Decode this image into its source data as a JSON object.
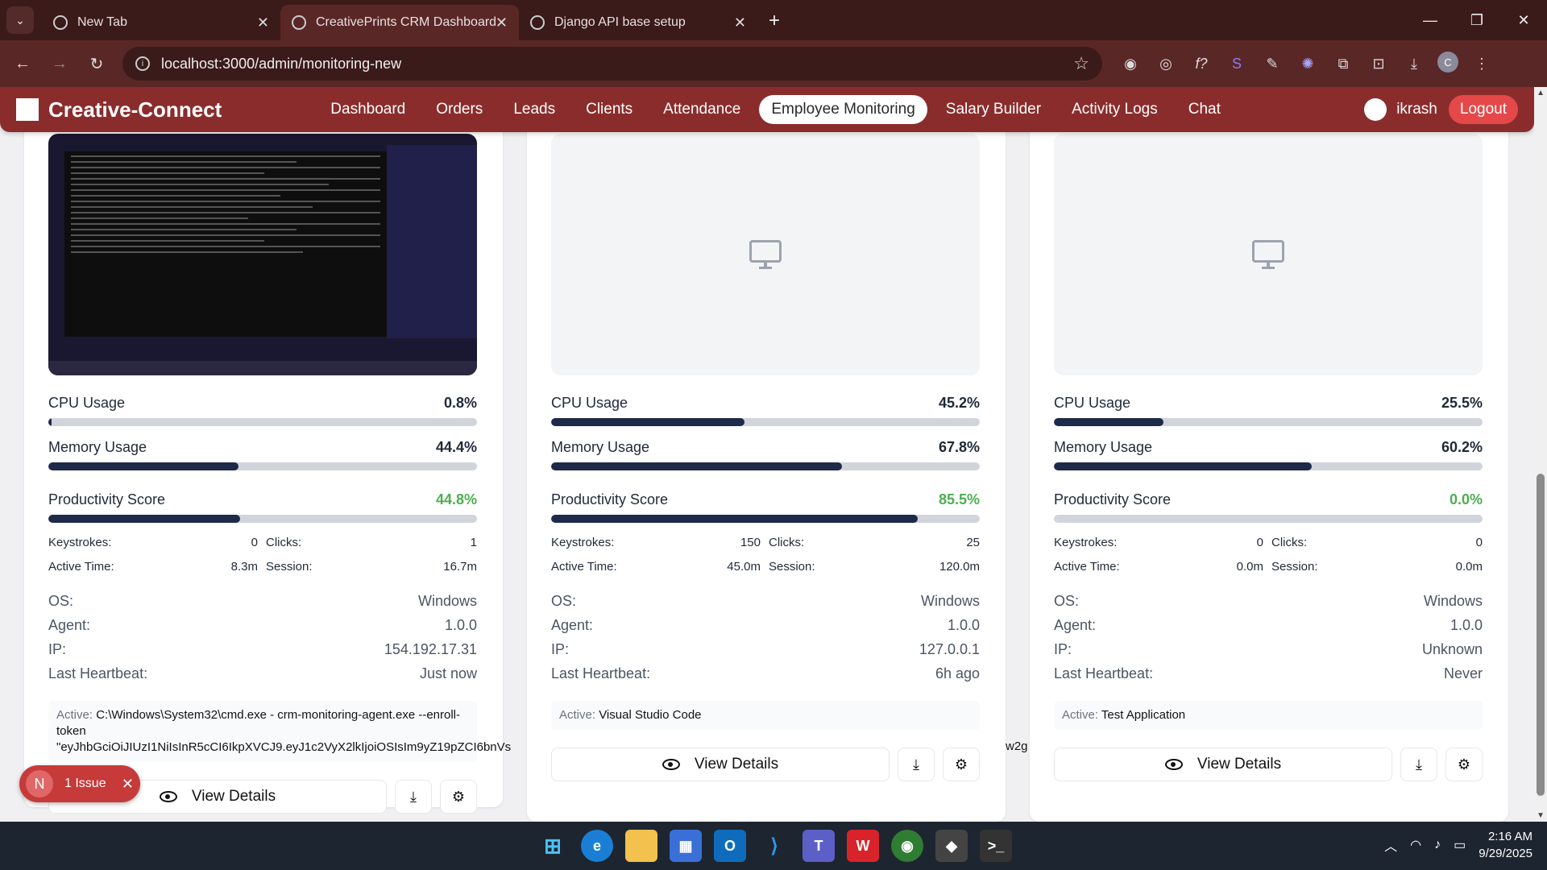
{
  "browser": {
    "tabs": [
      {
        "label": "New Tab",
        "active": false
      },
      {
        "label": "CreativePrints CRM Dashboard",
        "active": true
      },
      {
        "label": "Django API base setup",
        "active": false
      }
    ],
    "url": "localhost:3000/admin/monitoring-new",
    "profile_initial": "C"
  },
  "nav": {
    "brand": "Creative-Connect",
    "links": [
      "Dashboard",
      "Orders",
      "Leads",
      "Clients",
      "Attendance",
      "Employee Monitoring",
      "Salary Builder",
      "Activity Logs",
      "Chat"
    ],
    "active_link": "Employee Monitoring",
    "user": "ikrash",
    "logout": "Logout"
  },
  "labels": {
    "cpu": "CPU Usage",
    "memory": "Memory Usage",
    "productivity": "Productivity Score",
    "keystrokes": "Keystrokes:",
    "clicks": "Clicks:",
    "active_time": "Active Time:",
    "session": "Session:",
    "os": "OS:",
    "agent": "Agent:",
    "ip": "IP:",
    "heartbeat": "Last Heartbeat:",
    "active_prefix": "Active:",
    "view_details": "View Details"
  },
  "cards": [
    {
      "cpu": "0.8%",
      "cpu_pct": 0.8,
      "memory": "44.4%",
      "memory_pct": 44.4,
      "productivity": "44.8%",
      "productivity_pct": 44.8,
      "keystrokes": "0",
      "clicks": "1",
      "active_time": "8.3m",
      "session": "16.7m",
      "os": "Windows",
      "agent": "1.0.0",
      "ip": "154.192.17.31",
      "heartbeat": "Just now",
      "active_app": "C:\\Windows\\System32\\cmd.exe - crm-monitoring-agent.exe --enroll-token",
      "active_overflow": "\"eyJhbGciOiJIUzI1NiIsInR5cCI6IkpXVCJ9.eyJ1c2VyX2lkIjoiOSIsIm9yZ19pZCI6bnVs"
    },
    {
      "cpu": "45.2%",
      "cpu_pct": 45.2,
      "memory": "67.8%",
      "memory_pct": 67.8,
      "productivity": "85.5%",
      "productivity_pct": 85.5,
      "keystrokes": "150",
      "clicks": "25",
      "active_time": "45.0m",
      "session": "120.0m",
      "os": "Windows",
      "agent": "1.0.0",
      "ip": "127.0.0.1",
      "heartbeat": "6h ago",
      "active_app": "Visual Studio Code",
      "overflow_tail": "w2g"
    },
    {
      "cpu": "25.5%",
      "cpu_pct": 25.5,
      "memory": "60.2%",
      "memory_pct": 60.2,
      "productivity": "0.0%",
      "productivity_pct": 0.0,
      "keystrokes": "0",
      "clicks": "0",
      "active_time": "0.0m",
      "session": "0.0m",
      "os": "Windows",
      "agent": "1.0.0",
      "ip": "Unknown",
      "heartbeat": "Never",
      "active_app": "Test Application"
    }
  ],
  "issue_badge": {
    "initial": "N",
    "text": "1 Issue"
  },
  "clock": {
    "time": "2:16 AM",
    "date": "9/29/2025"
  },
  "colors": {
    "navbar": "#8b2c2c",
    "progress_fill": "#1e2a4a",
    "productivity_text": "#4caf50",
    "logout": "#e54848"
  }
}
